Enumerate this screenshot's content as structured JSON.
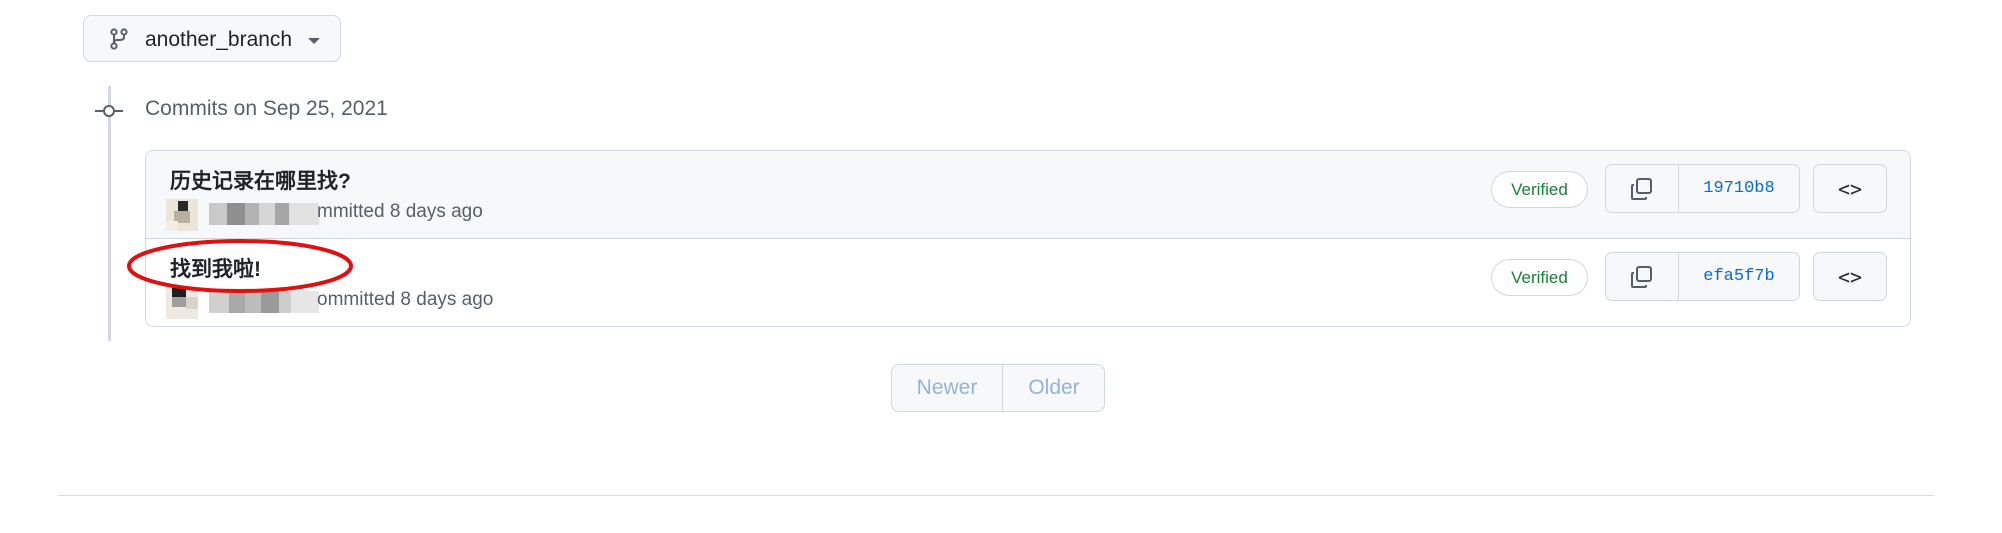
{
  "branch_selector": {
    "label": "another_branch",
    "icon": "git-branch-icon"
  },
  "timeline": {
    "day_heading": "Commits on Sep 25, 2021",
    "commits": [
      {
        "title": "历史记录在哪里找?",
        "meta": "mmitted 8 days ago",
        "verified_label": "Verified",
        "sha": "19710b8",
        "browse_label": "<>"
      },
      {
        "title": "找到我啦!",
        "meta": "ommitted 8 days ago",
        "verified_label": "Verified",
        "sha": "efa5f7b",
        "browse_label": "<>"
      }
    ]
  },
  "pagination": {
    "newer_label": "Newer",
    "older_label": "Older"
  },
  "colors": {
    "accent_link": "#0969da",
    "verified_green": "#1a7f37",
    "annotation_red": "#e01010",
    "border": "#d0d7de"
  }
}
